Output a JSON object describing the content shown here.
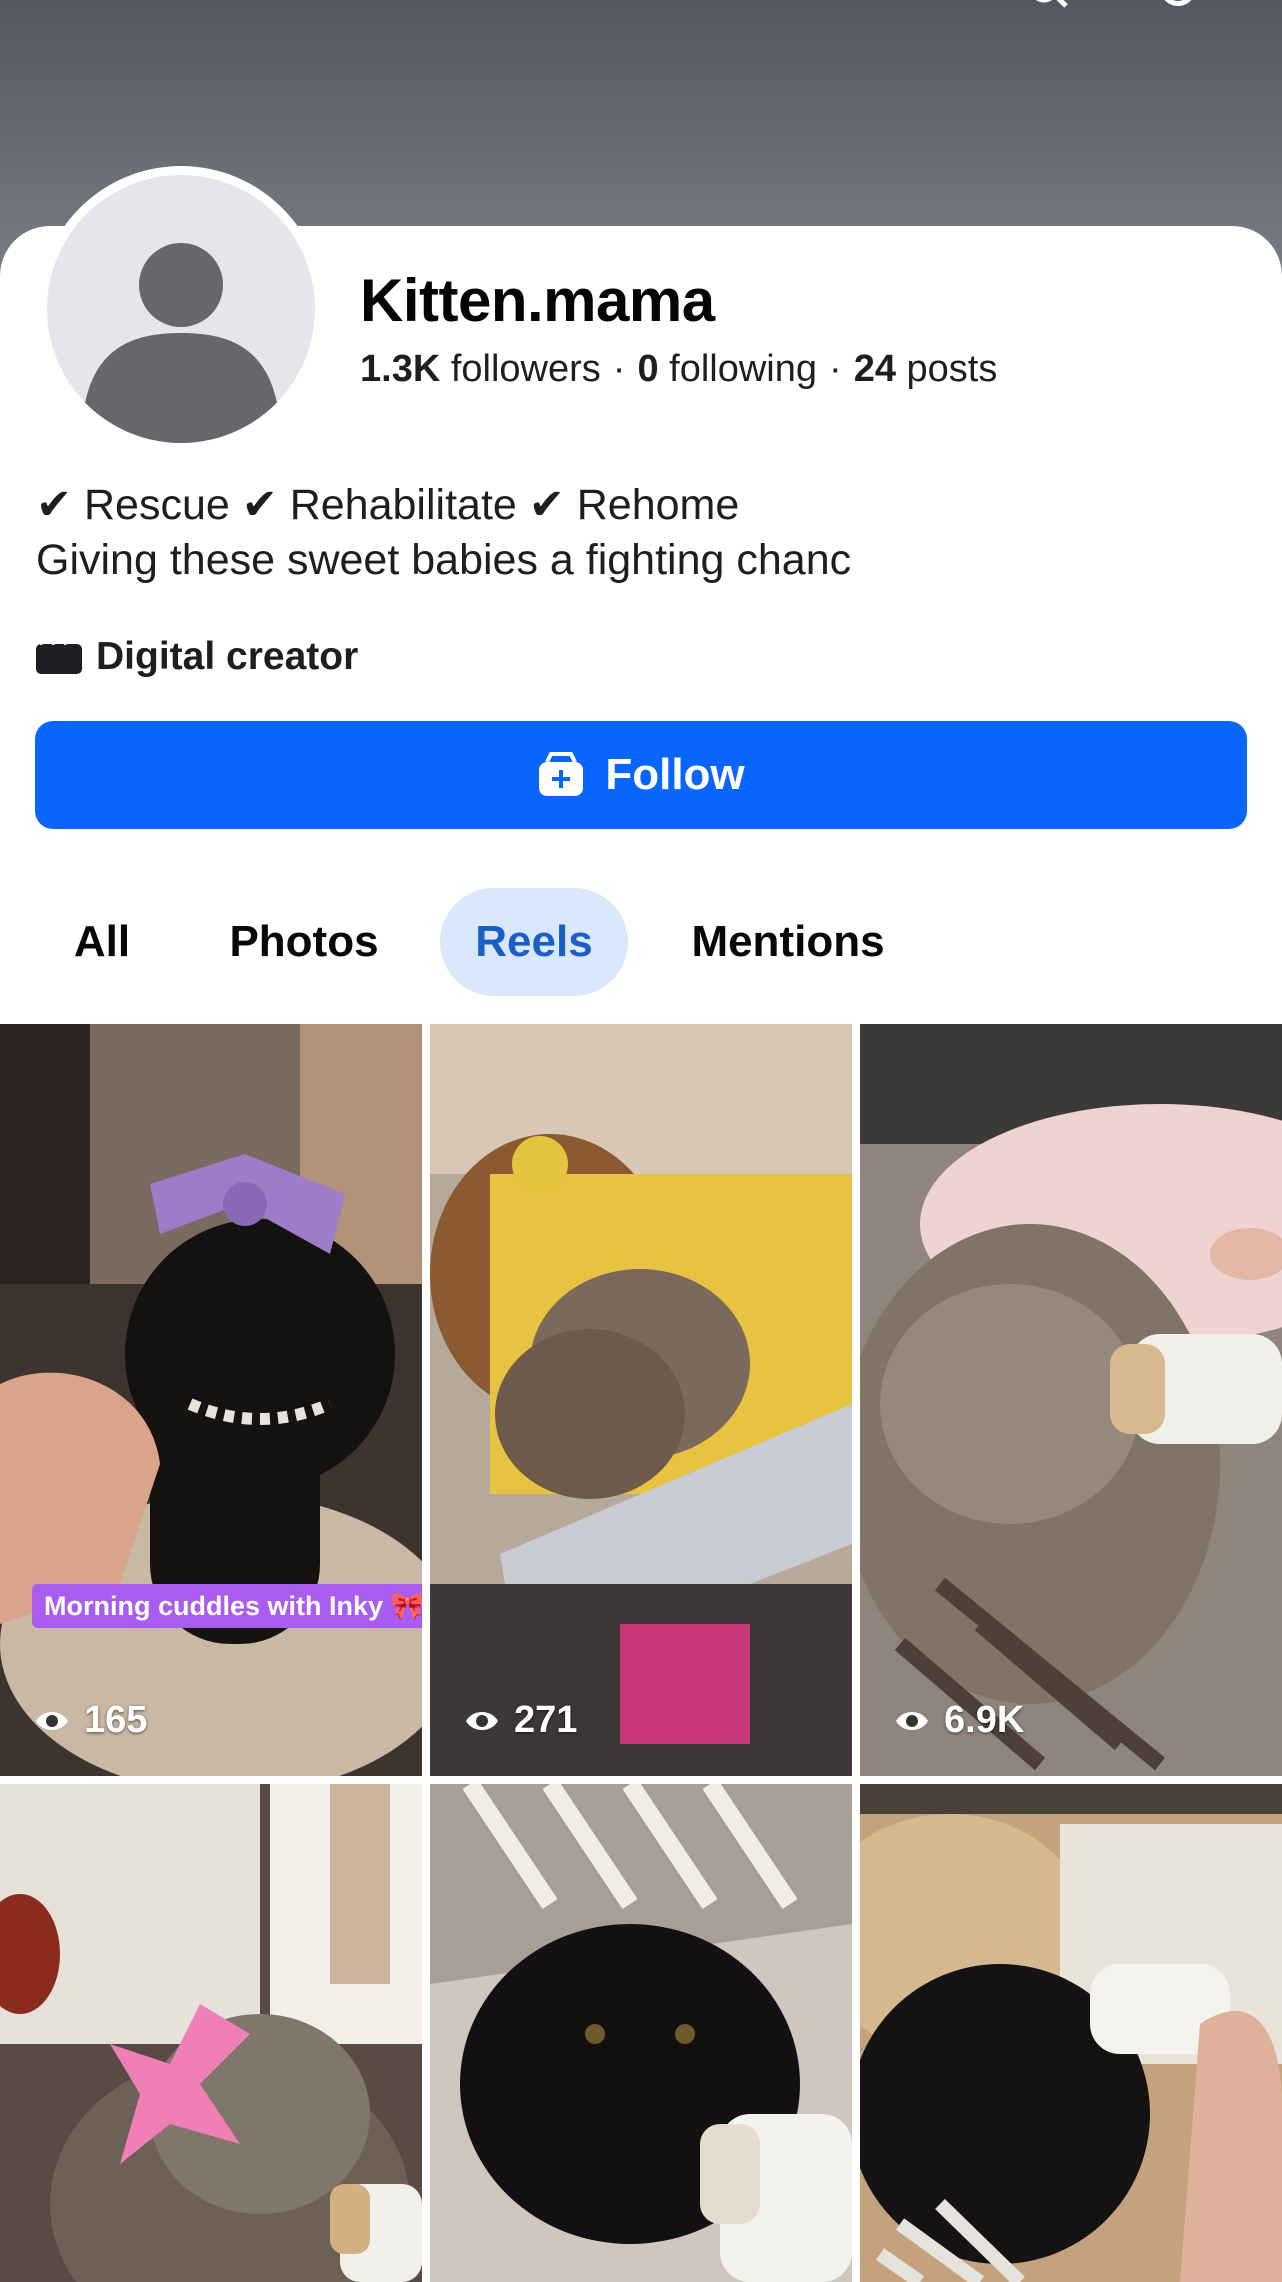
{
  "profile": {
    "name": "Kitten.mama",
    "stats": {
      "followers_count": "1.3K",
      "followers_label": "followers",
      "following_count": "0",
      "following_label": "following",
      "posts_count": "24",
      "posts_label": "posts",
      "separator": "·"
    },
    "bio": {
      "line1": {
        "check": "✔",
        "item1": "Rescue",
        "item2": "Rehabilitate",
        "item3": "Rehome"
      },
      "line2": "Giving these sweet babies a fighting chanc"
    },
    "category": "Digital creator"
  },
  "actions": {
    "follow_label": "Follow"
  },
  "tabs": [
    {
      "label": "All",
      "active": false
    },
    {
      "label": "Photos",
      "active": false
    },
    {
      "label": "Reels",
      "active": true
    },
    {
      "label": "Mentions",
      "active": false
    }
  ],
  "reels": [
    {
      "views": "165",
      "caption": "Morning cuddles with Inky 🎀",
      "content": "black kitten with purple bow"
    },
    {
      "views": "271",
      "content": "two tabby kittens in box"
    },
    {
      "views": "6.9K",
      "content": "tabby kitten drinking from bottle"
    },
    {
      "content": "tabby kitten with pink bow"
    },
    {
      "content": "black kitten with bottle"
    },
    {
      "content": "black kitten being bottle fed"
    }
  ],
  "colors": {
    "accent": "#0866ff",
    "active_tab_bg": "#dbe7fb",
    "active_tab_text": "#1a5fc5",
    "caption_bg": "#a85cf0"
  }
}
